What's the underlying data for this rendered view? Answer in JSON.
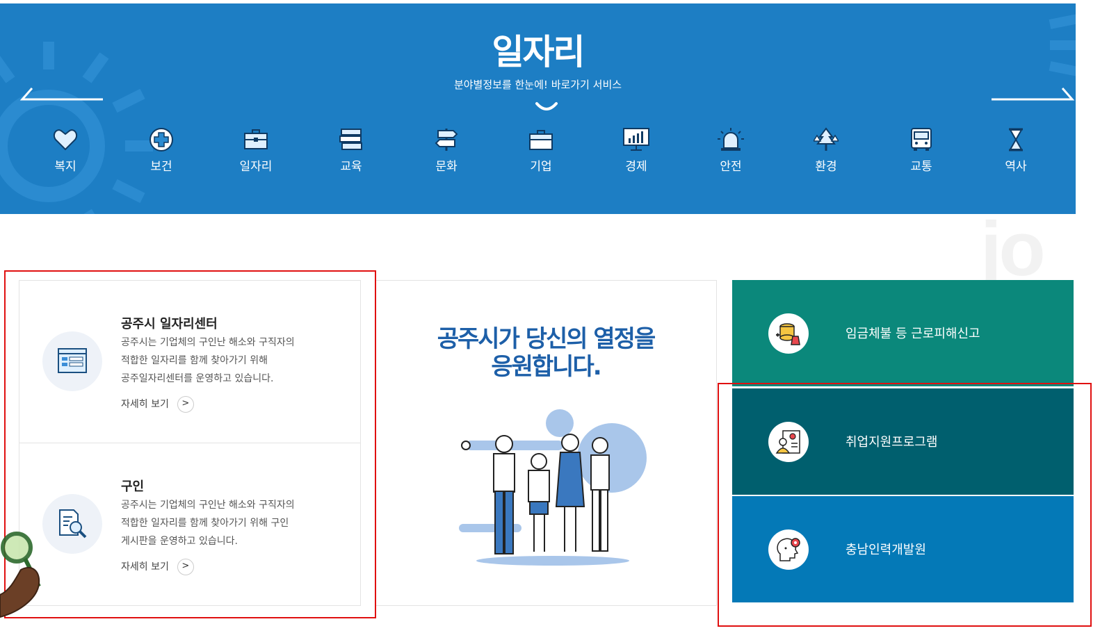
{
  "banner": {
    "title": "일자리",
    "subtitle": "분야별정보를 한눈에! 바로가기 서비스",
    "background_color": "#1d7ec4"
  },
  "categories": [
    {
      "label": "복지",
      "icon": "heart-icon"
    },
    {
      "label": "보건",
      "icon": "medical-cross-icon"
    },
    {
      "label": "일자리",
      "icon": "briefcase-icon"
    },
    {
      "label": "교육",
      "icon": "books-icon"
    },
    {
      "label": "문화",
      "icon": "signpost-icon"
    },
    {
      "label": "기업",
      "icon": "suitcase-icon"
    },
    {
      "label": "경제",
      "icon": "chart-monitor-icon"
    },
    {
      "label": "안전",
      "icon": "alarm-light-icon"
    },
    {
      "label": "환경",
      "icon": "trees-icon"
    },
    {
      "label": "교통",
      "icon": "bus-icon"
    },
    {
      "label": "역사",
      "icon": "hourglass-icon"
    }
  ],
  "watermark": "jo",
  "services": [
    {
      "title": "공주시 일자리센터",
      "desc_lines": [
        "공주시는 기업체의 구인난 해소와 구직자의",
        "적합한 일자리를 함께 찾아가기 위해",
        "공주일자리센터를 운영하고 있습니다."
      ],
      "more": "자세히 보기",
      "icon": "window-list-icon"
    },
    {
      "title": "구인",
      "desc_lines": [
        "공주시는 기업체의 구인난 해소와 구직자의",
        "적합한 일자리를 함께 찾아가기 위해 구인",
        "게시판을 운영하고 있습니다."
      ],
      "more": "자세히 보기",
      "icon": "document-search-icon"
    }
  ],
  "slogan": {
    "line1": "공주시가 당신의 열정을",
    "line2": "응원합니다."
  },
  "quick_links": [
    {
      "label": "임금체불 등 근로피해신고",
      "color": "#0b887b",
      "icon": "coin-stack-icon"
    },
    {
      "label": "취업지원프로그램",
      "color": "#005f6e",
      "icon": "profile-document-icon"
    },
    {
      "label": "충남인력개발원",
      "color": "#0479b7",
      "icon": "head-gear-icon"
    }
  ],
  "colors": {
    "highlight_red": "#e01010",
    "slogan_blue": "#1d5fa8"
  }
}
